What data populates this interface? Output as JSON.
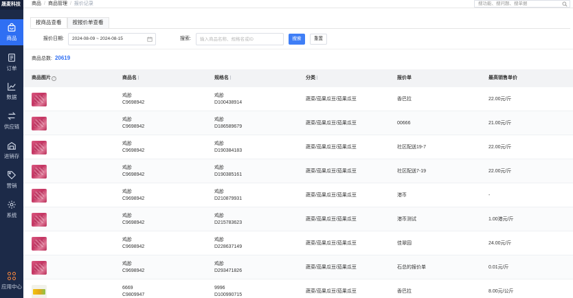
{
  "app": {
    "logo": "晟麦科技"
  },
  "nav": [
    {
      "label": "商品",
      "icon": "bag-icon",
      "active": true
    },
    {
      "label": "订单",
      "icon": "order-doc-icon"
    },
    {
      "label": "数据",
      "icon": "chart-icon"
    },
    {
      "label": "供应链",
      "icon": "exchange-icon"
    },
    {
      "label": "进销存",
      "icon": "warehouse-icon"
    },
    {
      "label": "营销",
      "icon": "tag-icon"
    },
    {
      "label": "系统",
      "icon": "gear-icon"
    }
  ],
  "app_center": "应用中心",
  "breadcrumb": {
    "item1": "商品",
    "item2": "商品管理",
    "current": "报价记录"
  },
  "top_search_placeholder": "搜功能、搜问题、搜单据",
  "tabs": {
    "tab1": "按商品查看",
    "tab2": "按报价单查看"
  },
  "filter": {
    "date_label": "报价日期:",
    "date_value": "2024-08-09 ~ 2024-08-15",
    "search_label": "搜索:",
    "search_placeholder": "输入商品名称、规格名或ID",
    "search_button": "搜索",
    "reset_button": "重置"
  },
  "total": {
    "label": "商品总数:",
    "value": "20619"
  },
  "columns": {
    "image": "商品图片",
    "name": "商品名",
    "spec": "规格名",
    "category": "分类",
    "quote": "报价单",
    "price": "最高销售单价"
  },
  "rows": [
    {
      "name": "鸡胗",
      "code": "C9698942",
      "spec": "鸡胗",
      "spec_code": "D100438914",
      "category": "蔬菜/茄果瓜豆/茄果瓜豆",
      "quote": "香巴拉",
      "price": "22.00元/斤",
      "thumb": "pink"
    },
    {
      "name": "鸡胗",
      "code": "C9698942",
      "spec": "鸡胗",
      "spec_code": "D186589679",
      "category": "蔬菜/茄果瓜豆/茄果瓜豆",
      "quote": "00666",
      "price": "21.00元/斤",
      "thumb": "pink"
    },
    {
      "name": "鸡胗",
      "code": "C9698942",
      "spec": "鸡胗",
      "spec_code": "D190384183",
      "category": "蔬菜/茄果瓜豆/茄果瓜豆",
      "quote": "社区配送19-7",
      "price": "22.00元/斤",
      "thumb": "pink"
    },
    {
      "name": "鸡胗",
      "code": "C9698942",
      "spec": "鸡胗",
      "spec_code": "D190385161",
      "category": "蔬菜/茄果瓜豆/茄果瓜豆",
      "quote": "社区配送7-19",
      "price": "22.00元/斤",
      "thumb": "pink"
    },
    {
      "name": "鸡胗",
      "code": "C9698942",
      "spec": "鸡胗",
      "spec_code": "D210879931",
      "category": "蔬菜/茄果瓜豆/茄果瓜豆",
      "quote": "港币",
      "price": "-",
      "thumb": "pink"
    },
    {
      "name": "鸡胗",
      "code": "C9698942",
      "spec": "鸡胗",
      "spec_code": "D215783623",
      "category": "蔬菜/茄果瓜豆/茄果瓜豆",
      "quote": "港币测试",
      "price": "1.00港元/斤",
      "thumb": "pink"
    },
    {
      "name": "鸡胗",
      "code": "C9698942",
      "spec": "鸡胗",
      "spec_code": "D228637149",
      "category": "蔬菜/茄果瓜豆/茄果瓜豆",
      "quote": "佳翠园",
      "price": "24.00元/斤",
      "thumb": "pink"
    },
    {
      "name": "鸡胗",
      "code": "C9698942",
      "spec": "鸡胗",
      "spec_code": "D293471826",
      "category": "蔬菜/茄果瓜豆/茄果瓜豆",
      "quote": "石总的报价单",
      "price": "0.01元/斤",
      "thumb": "pink"
    },
    {
      "name": "6669",
      "code": "C9809947",
      "spec": "9996",
      "spec_code": "D100990715",
      "category": "蔬菜/茄果瓜豆/茄果瓜豆",
      "quote": "香巴拉",
      "price": "8.00元/公斤",
      "thumb": "yellow"
    }
  ]
}
